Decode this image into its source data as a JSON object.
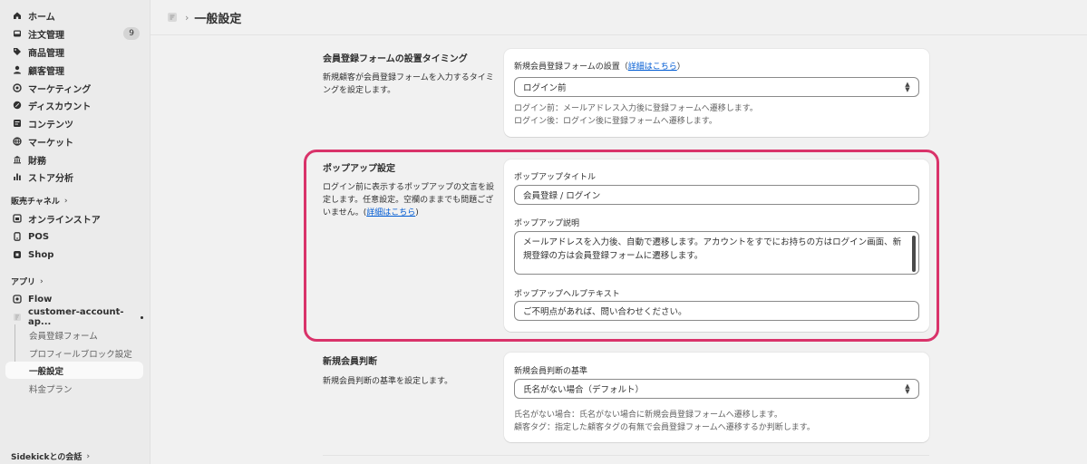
{
  "sidebar": {
    "main_items": [
      {
        "label": "ホーム",
        "icon": "home-icon"
      },
      {
        "label": "注文管理",
        "icon": "inbox-icon",
        "badge": "9"
      },
      {
        "label": "商品管理",
        "icon": "tag-icon"
      },
      {
        "label": "顧客管理",
        "icon": "person-icon"
      },
      {
        "label": "マーケティング",
        "icon": "target-icon"
      },
      {
        "label": "ディスカウント",
        "icon": "discount-icon"
      },
      {
        "label": "コンテンツ",
        "icon": "content-icon"
      },
      {
        "label": "マーケット",
        "icon": "globe-icon"
      },
      {
        "label": "財務",
        "icon": "bank-icon"
      },
      {
        "label": "ストア分析",
        "icon": "chart-icon"
      }
    ],
    "sales_channels": {
      "title": "販売チャネル",
      "items": [
        {
          "label": "オンラインストア",
          "icon": "store-icon"
        },
        {
          "label": "POS",
          "icon": "pos-icon"
        },
        {
          "label": "Shop",
          "icon": "shop-icon"
        }
      ]
    },
    "apps": {
      "title": "アプリ",
      "items": [
        {
          "label": "Flow",
          "icon": "flow-icon"
        },
        {
          "label": "customer-account-ap...",
          "icon": "app-icon"
        }
      ],
      "sub_items": [
        "会員登録フォーム",
        "プロフィールブロック設定",
        "一般設定",
        "料金プラン"
      ],
      "active_sub": "一般設定"
    },
    "sidekick": "Sidekickとの会話"
  },
  "header": {
    "title": "一般設定",
    "breadcrumb_icon": "app-icon"
  },
  "sections": {
    "timing": {
      "title": "会員登録フォームの設置タイミング",
      "desc": "新規顧客が会員登録フォームを入力するタイミングを設定します。",
      "field_label": "新規会員登録フォームの設置（",
      "field_link": "詳細はこちら",
      "field_label_end": "）",
      "select_value": "ログイン前",
      "help_1": "ログイン前：メールアドレス入力後に登録フォームへ遷移します。",
      "help_2": "ログイン後：ログイン後に登録フォームへ遷移します。"
    },
    "popup": {
      "title": "ポップアップ設定",
      "desc": "ログイン前に表示するポップアップの文言を設定します。任意設定。空欄のままでも問題ございません。(",
      "desc_link": "詳細はこちら",
      "desc_end": ")",
      "title_label": "ポップアップタイトル",
      "title_value": "会員登録 / ログイン",
      "desc_label": "ポップアップ説明",
      "desc_value": "メールアドレスを入力後、自動で遷移します。アカウントをすでにお持ちの方はログイン画面、新規登録の方は会員登録フォームに遷移します。",
      "help_label": "ポップアップヘルプテキスト",
      "help_value": "ご不明点があれば、問い合わせください。"
    },
    "judge": {
      "title": "新規会員判断",
      "desc": "新規会員判断の基準を設定します。",
      "field_label": "新規会員判断の基準",
      "select_value": "氏名がない場合（デフォルト）",
      "help_1": "氏名がない場合：氏名がない場合に新規会員登録フォームへ遷移します。",
      "help_2": "顧客タグ：指定した顧客タグの有無で会員登録フォームへ遷移するか判断します。"
    }
  },
  "colors": {
    "highlight": "#d9336a",
    "link": "#005bd3",
    "sidebar_bg": "#ebebeb",
    "page_bg": "#f1f1f1"
  }
}
